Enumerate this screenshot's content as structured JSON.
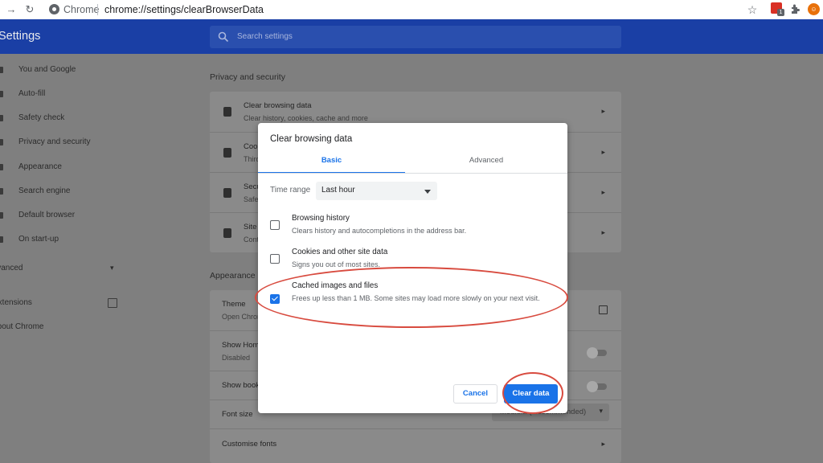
{
  "browser": {
    "tab_label": "Chrome",
    "url_path": "chrome://settings/clearBrowserData",
    "extension_badge": "1",
    "icons": [
      "forward-icon",
      "reload-icon",
      "bookmark-star-icon",
      "extensions-puzzle-icon",
      "profile-avatar-icon"
    ]
  },
  "header": {
    "title": "Settings",
    "search_placeholder": "Search settings"
  },
  "sidebar": {
    "items": [
      {
        "label": "You and Google"
      },
      {
        "label": "Auto-fill"
      },
      {
        "label": "Safety check"
      },
      {
        "label": "Privacy and security"
      },
      {
        "label": "Appearance"
      },
      {
        "label": "Search engine"
      },
      {
        "label": "Default browser"
      },
      {
        "label": "On start-up"
      }
    ],
    "advanced": "Advanced",
    "extensions": "Extensions",
    "about": "About Chrome"
  },
  "privacy": {
    "title": "Privacy and security",
    "rows": [
      {
        "title": "Clear browsing data",
        "subtitle": "Clear history, cookies, cache and more"
      },
      {
        "title": "Cookies and other site data",
        "subtitle": "Third-party cookies are blocked in Incognito mode"
      },
      {
        "title": "Security",
        "subtitle": "Safe Browsing (protection from dangerous sites) and other security settings"
      },
      {
        "title": "Site settings",
        "subtitle": "Controls what information sites can use and show"
      }
    ]
  },
  "appearance": {
    "title": "Appearance",
    "theme_title": "Theme",
    "theme_sub": "Open Chrome Web Store",
    "home_title": "Show Home button",
    "home_sub": "Disabled",
    "bookmarks_title": "Show bookmarks bar",
    "font_title": "Font size",
    "font_value": "Medium (Recommended)",
    "fonts_title": "Customise fonts"
  },
  "dialog": {
    "title": "Clear browsing data",
    "tabs": [
      "Basic",
      "Advanced"
    ],
    "active_tab": "Basic",
    "time_range_label": "Time range",
    "time_range_value": "Last hour",
    "options": [
      {
        "title": "Browsing history",
        "desc": "Clears history and autocompletions in the address bar.",
        "checked": false
      },
      {
        "title": "Cookies and other site data",
        "desc": "Signs you out of most sites.",
        "checked": false
      },
      {
        "title": "Cached images and files",
        "desc": "Frees up less than 1 MB. Some sites may load more slowly on your next visit.",
        "checked": true
      }
    ],
    "cancel": "Cancel",
    "clear": "Clear data"
  },
  "colors": {
    "header_blue": "#1a3fa5",
    "accent_blue": "#1a73e8",
    "annotation_red": "#d84b3f"
  }
}
